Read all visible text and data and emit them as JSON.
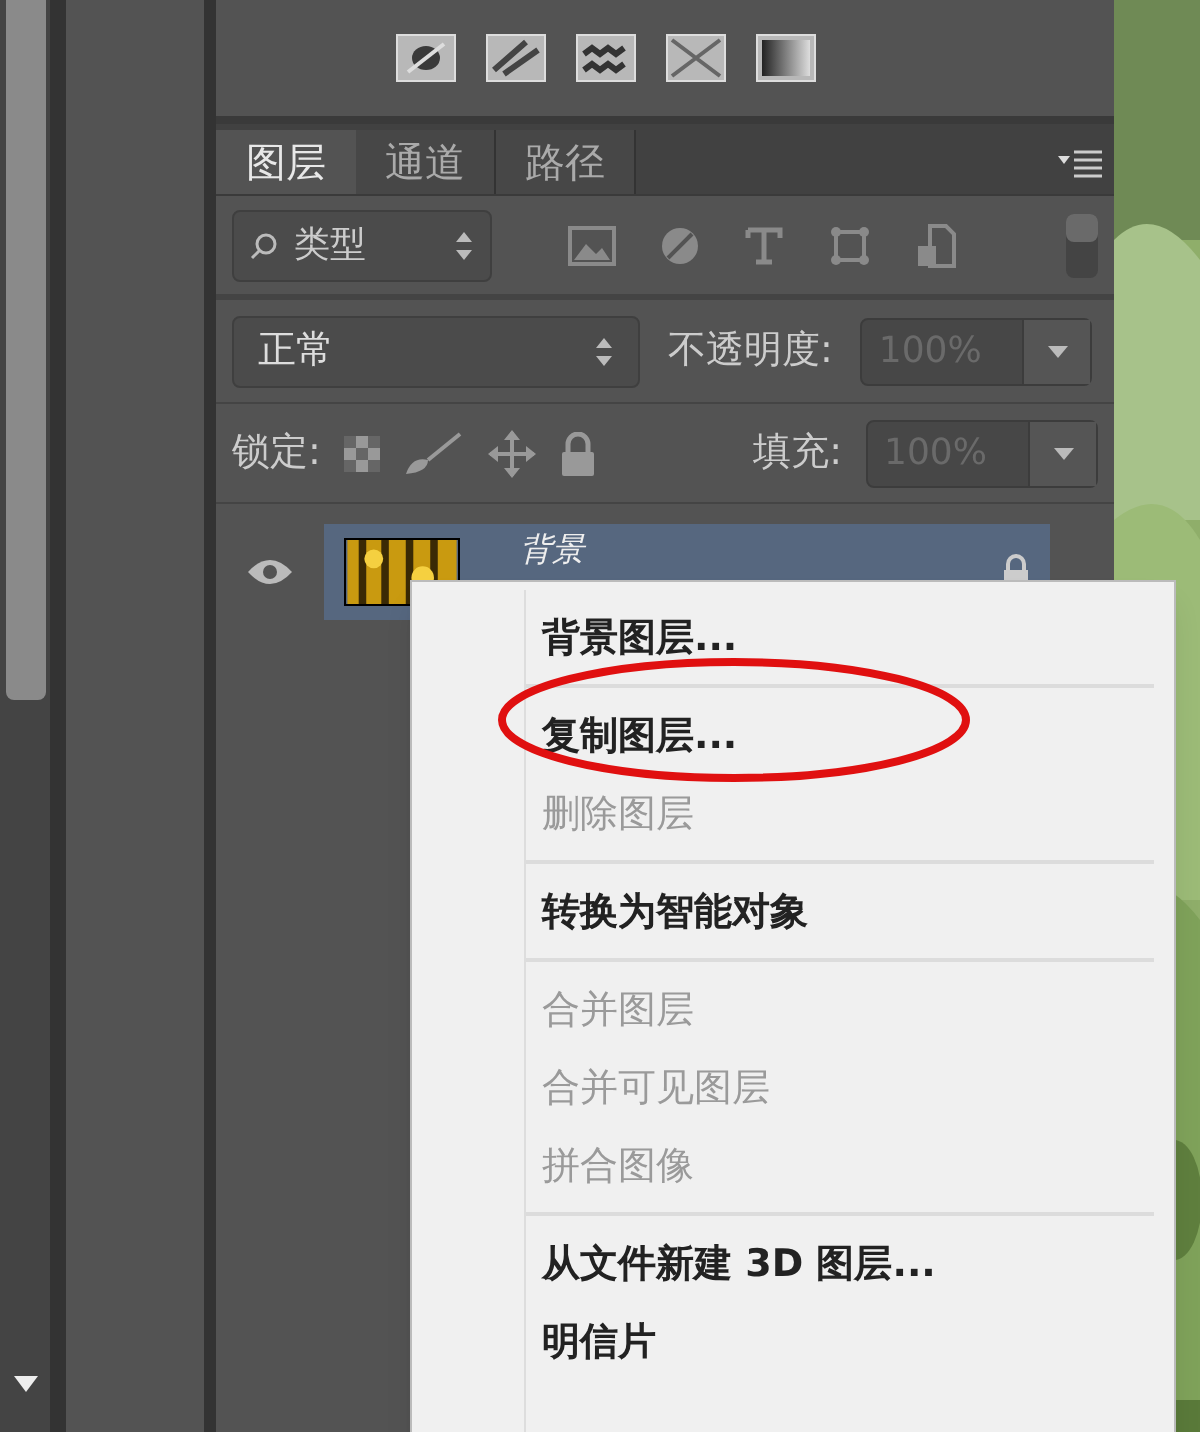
{
  "tabs": [
    {
      "label": "图层",
      "selected": true
    },
    {
      "label": "通道",
      "selected": false
    },
    {
      "label": "路径",
      "selected": false
    }
  ],
  "filter": {
    "value": "类型"
  },
  "blend_mode": {
    "value": "正常"
  },
  "opacity": {
    "label": "不透明度:",
    "value": "100%",
    "disabled": true
  },
  "lock": {
    "label": "锁定:"
  },
  "fill": {
    "label": "填充:",
    "value": "100%",
    "disabled": true
  },
  "layers": [
    {
      "name": "背景",
      "visible": true,
      "selected": true,
      "locked": true
    }
  ],
  "context_menu": {
    "groups": [
      [
        {
          "label": "背景图层...",
          "disabled": false
        }
      ],
      [
        {
          "label": "复制图层...",
          "disabled": false
        },
        {
          "label": "删除图层",
          "disabled": true
        }
      ],
      [
        {
          "label": "转换为智能对象",
          "disabled": false
        }
      ],
      [
        {
          "label": "合并图层",
          "disabled": true
        },
        {
          "label": "合并可见图层",
          "disabled": true
        },
        {
          "label": "拼合图像",
          "disabled": true
        }
      ],
      [
        {
          "label": "从文件新建 3D 图层...",
          "disabled": false
        },
        {
          "label": "明信片",
          "disabled": false
        }
      ]
    ]
  }
}
